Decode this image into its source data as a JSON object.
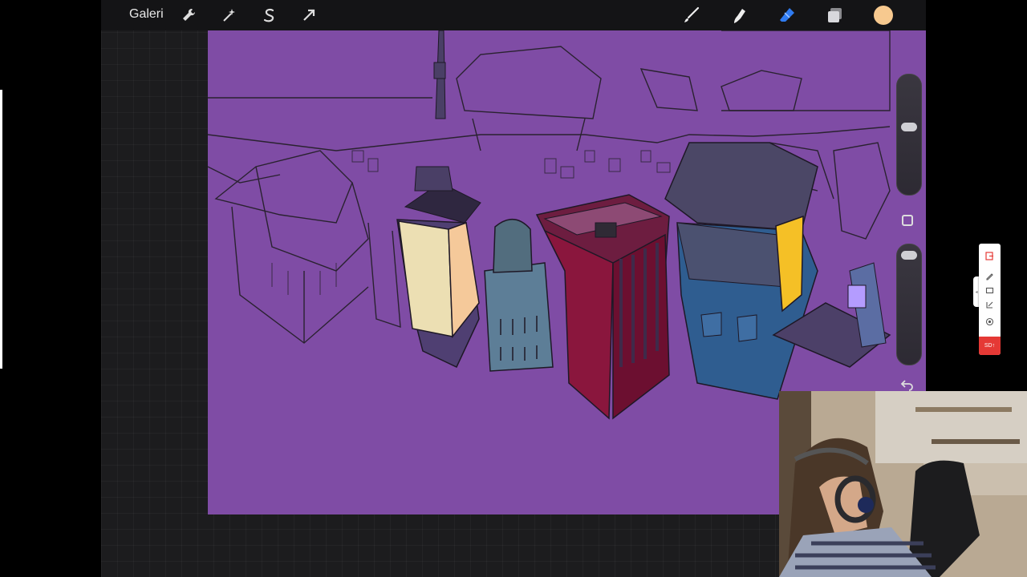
{
  "app": {
    "gallery_label": "Galeri"
  },
  "topbar": {
    "left_tools": [
      "wrench-icon",
      "magic-wand-icon",
      "selection-s-icon",
      "move-arrow-icon"
    ],
    "right_tools": [
      "brush-icon",
      "smudge-icon",
      "eraser-icon",
      "layers-icon",
      "color-swatch"
    ],
    "active_color": "#f7c98f",
    "eraser_color": "#2f7bf0"
  },
  "canvas": {
    "background": "#7f4ca5"
  },
  "sidebar": {
    "controls": [
      "brush-size-slider",
      "modify-button",
      "opacity-slider",
      "undo-button"
    ]
  },
  "recorder": {
    "badge_label": "SD",
    "badge_color": "#e53935"
  }
}
